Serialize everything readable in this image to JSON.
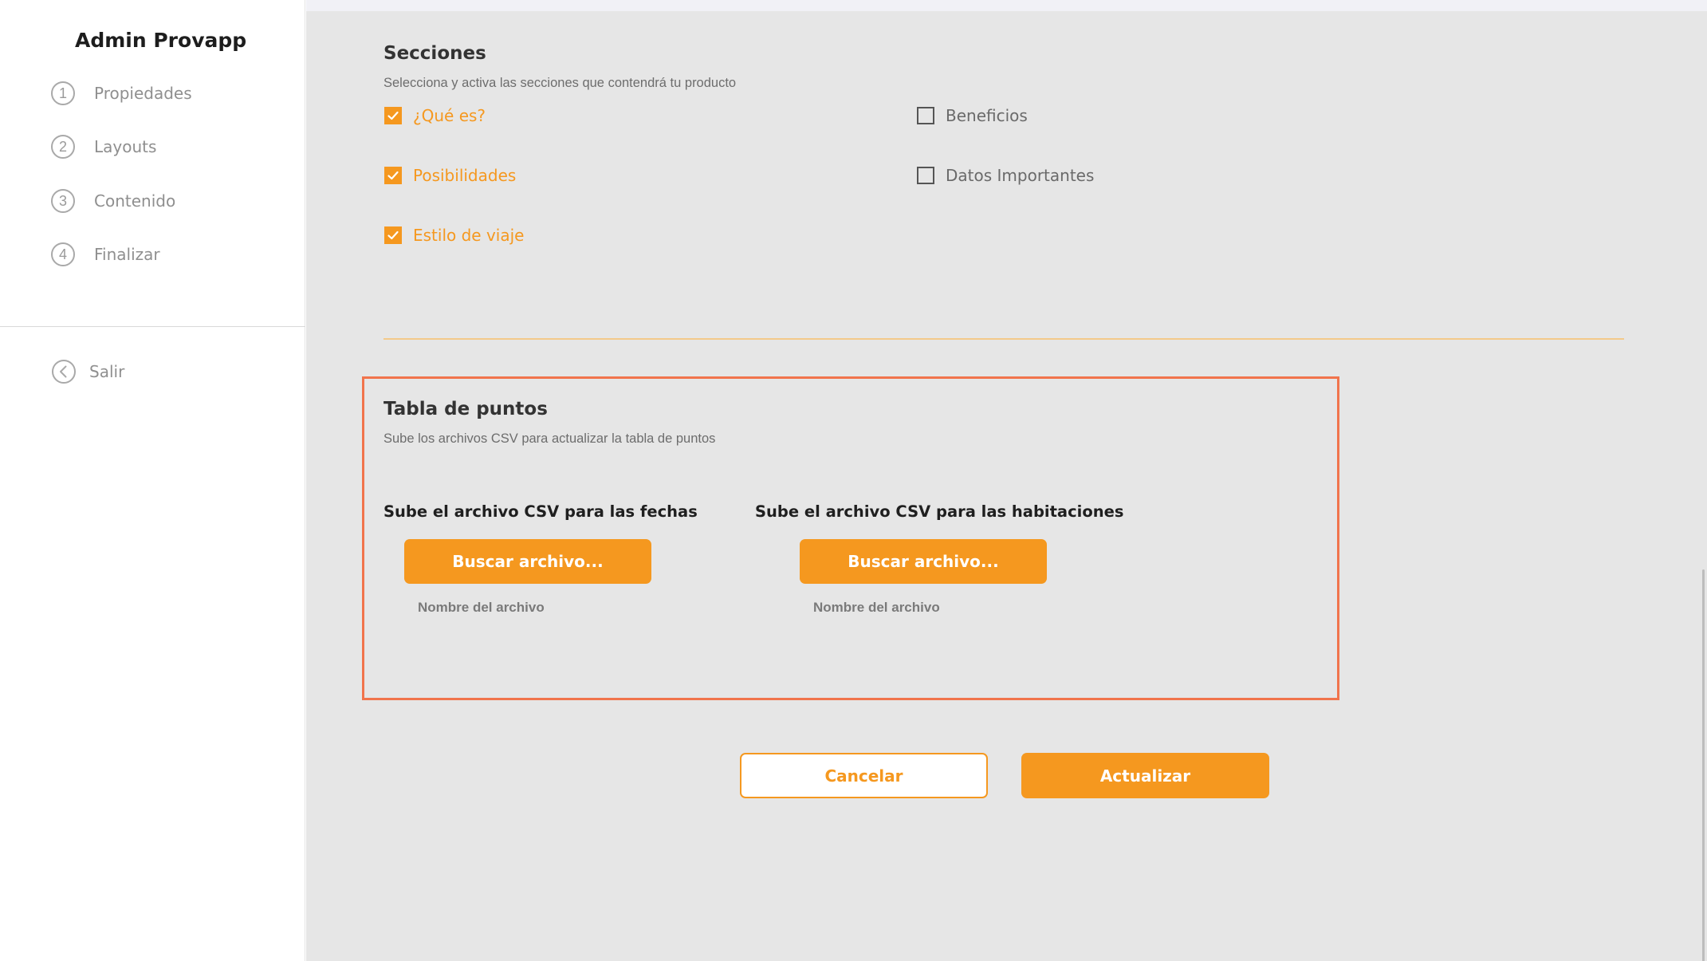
{
  "sidebar": {
    "brand": "Admin Provapp",
    "steps": [
      {
        "num": "1",
        "label": "Propiedades"
      },
      {
        "num": "2",
        "label": "Layouts"
      },
      {
        "num": "3",
        "label": "Contenido"
      },
      {
        "num": "4",
        "label": "Finalizar"
      }
    ],
    "exit_label": "Salir",
    "exit_icon": "chevron-left-circle-icon"
  },
  "sections": {
    "title": "Secciones",
    "subtitle": "Selecciona y activa las secciones que contendrá tu producto",
    "options": [
      {
        "label": "¿Qué es?",
        "checked": true
      },
      {
        "label": "Beneficios",
        "checked": false
      },
      {
        "label": "Posibilidades",
        "checked": true
      },
      {
        "label": "Datos Importantes",
        "checked": false
      },
      {
        "label": "Estilo de viaje",
        "checked": true
      }
    ]
  },
  "points_table": {
    "title": "Tabla de puntos",
    "subtitle": "Sube los archivos CSV para actualizar la tabla de puntos",
    "uploads": [
      {
        "label": "Sube el archivo CSV para las fechas",
        "button": "Buscar archivo...",
        "filename": "Nombre del archivo"
      },
      {
        "label": "Sube el archivo CSV para las habitaciones",
        "button": "Buscar archivo...",
        "filename": "Nombre del archivo"
      }
    ]
  },
  "actions": {
    "cancel": "Cancelar",
    "update": "Actualizar"
  },
  "colors": {
    "accent": "#f5981f",
    "highlight_border": "#f1744c",
    "main_bg": "#e6e6e6"
  }
}
